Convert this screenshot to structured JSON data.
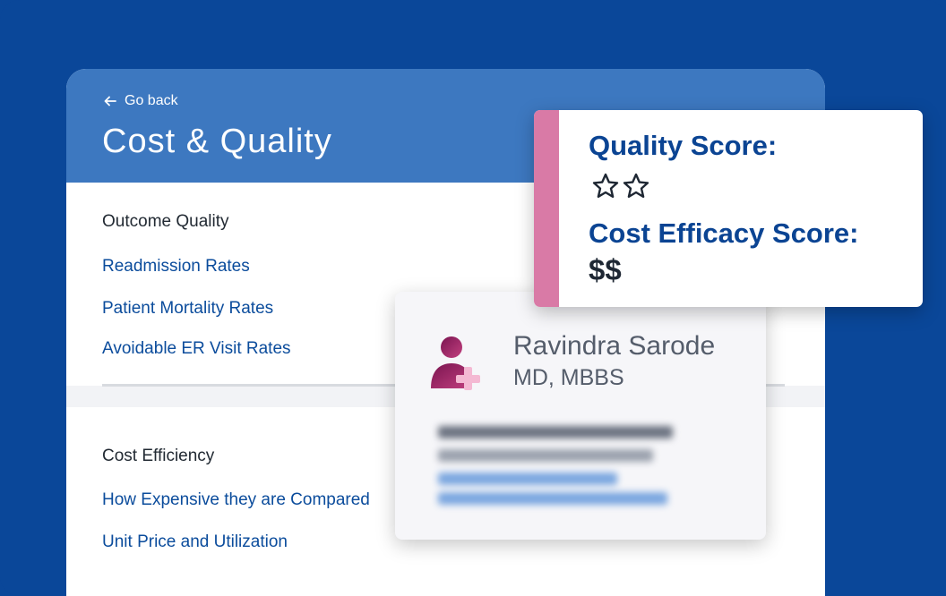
{
  "header": {
    "back_label": "Go back",
    "title": "Cost & Quality"
  },
  "sections": {
    "outcome_quality": {
      "title": "Outcome Quality",
      "links": [
        "Readmission Rates",
        "Patient Mortality Rates",
        "Avoidable ER Visit Rates"
      ]
    },
    "cost_efficiency": {
      "title": "Cost Efficiency",
      "links": [
        "How Expensive they are Compared",
        "Unit Price and Utilization"
      ]
    }
  },
  "doctor": {
    "name": "Ravindra Sarode",
    "credentials": "MD, MBBS",
    "icon": "doctor-plus-icon"
  },
  "scores": {
    "quality_label": "Quality Score:",
    "quality_stars": 2,
    "cost_label": "Cost Efficacy Score:",
    "cost_value": "$$"
  },
  "colors": {
    "background": "#0a4799",
    "header": "#3d78c0",
    "link": "#0b4c9c",
    "score_heading": "#0b4493",
    "accent_pink": "#d97aa6"
  }
}
